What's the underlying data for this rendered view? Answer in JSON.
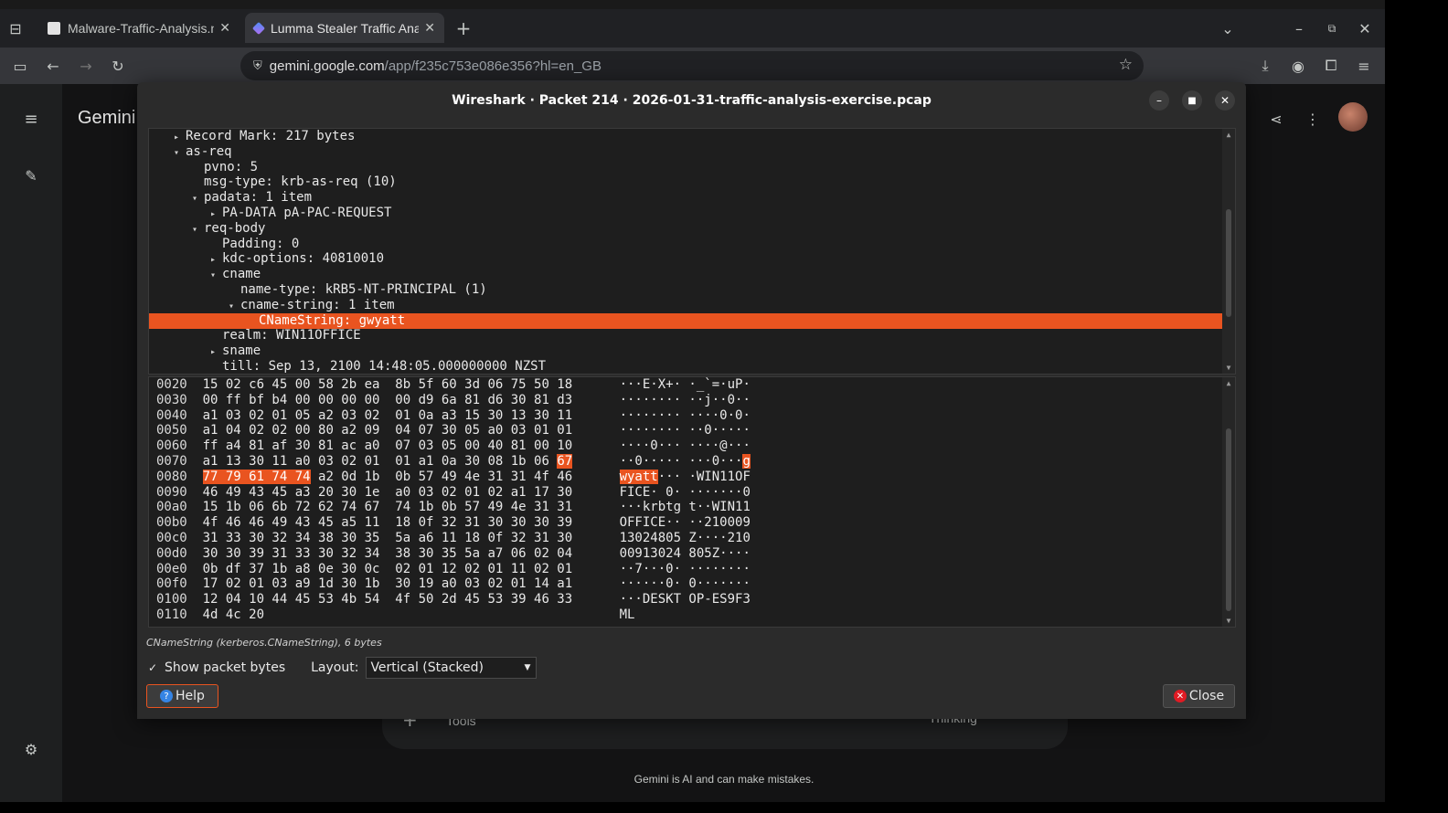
{
  "browser": {
    "tabs": [
      {
        "title": "Malware-Traffic-Analysis.net",
        "close": "✕"
      },
      {
        "title": "Lumma Stealer Traffic Analysis",
        "close": "✕"
      }
    ],
    "new_tab": "+",
    "url_host": "gemini.google.com",
    "url_path": "/app/f235c753e086e356?hl=en_GB"
  },
  "gemini": {
    "title": "Gemini",
    "disclaimer": "Gemini is AI and can make mistakes.",
    "tools_label": "Tools",
    "mode_label": "Thinking"
  },
  "wireshark": {
    "title": "Wireshark · Packet 214 · 2026-01-31-traffic-analysis-exercise.pcap",
    "tree": [
      {
        "indent": 1,
        "arrow": "▸",
        "text": "Record Mark: 217 bytes"
      },
      {
        "indent": 1,
        "arrow": "▾",
        "text": "as-req"
      },
      {
        "indent": 2,
        "arrow": "",
        "text": "pvno: 5"
      },
      {
        "indent": 2,
        "arrow": "",
        "text": "msg-type: krb-as-req (10)"
      },
      {
        "indent": 2,
        "arrow": "▾",
        "text": "padata: 1 item"
      },
      {
        "indent": 3,
        "arrow": "▸",
        "text": "PA-DATA pA-PAC-REQUEST"
      },
      {
        "indent": 2,
        "arrow": "▾",
        "text": "req-body"
      },
      {
        "indent": 3,
        "arrow": "",
        "text": "Padding: 0"
      },
      {
        "indent": 3,
        "arrow": "▸",
        "text": "kdc-options: 40810010"
      },
      {
        "indent": 3,
        "arrow": "▾",
        "text": "cname"
      },
      {
        "indent": 4,
        "arrow": "",
        "text": "name-type: kRB5-NT-PRINCIPAL (1)"
      },
      {
        "indent": 4,
        "arrow": "▾",
        "text": "cname-string: 1 item"
      },
      {
        "indent": 5,
        "arrow": "",
        "text": "CNameString: gwyatt",
        "selected": true
      },
      {
        "indent": 3,
        "arrow": "",
        "text": "realm: WIN11OFFICE"
      },
      {
        "indent": 3,
        "arrow": "▸",
        "text": "sname"
      },
      {
        "indent": 3,
        "arrow": "",
        "text": "till: Sep 13, 2100 14:48:05.000000000 NZST"
      }
    ],
    "hex": [
      {
        "off": "0020",
        "bytes": "15 02 c6 45 00 58 2b ea  8b 5f 60 3d 06 75 50 18",
        "ascii": "···E·X+· ·_`=·uP·"
      },
      {
        "off": "0030",
        "bytes": "00 ff bf b4 00 00 00 00  00 d9 6a 81 d6 30 81 d3",
        "ascii": "········ ··j··0··"
      },
      {
        "off": "0040",
        "bytes": "a1 03 02 01 05 a2 03 02  01 0a a3 15 30 13 30 11",
        "ascii": "········ ····0·0·"
      },
      {
        "off": "0050",
        "bytes": "a1 04 02 02 00 80 a2 09  04 07 30 05 a0 03 01 01",
        "ascii": "········ ··0·····"
      },
      {
        "off": "0060",
        "bytes": "ff a4 81 af 30 81 ac a0  07 03 05 00 40 81 00 10",
        "ascii": "····0··· ····@···"
      },
      {
        "off": "0070",
        "bytes_pre": "a1 13 30 11 a0 03 02 01  01 a1 0a 30 08 1b 06 ",
        "bytes_hl": "67",
        "ascii_pre": "··0····· ···0···",
        "ascii_hl": "g"
      },
      {
        "off": "0080",
        "bytes_hl": "77 79 61 74 74",
        "bytes_post": " a2 0d 1b  0b 57 49 4e 31 31 4f 46",
        "ascii_hl": "wyatt",
        "ascii_post": "··· ·WIN11OF"
      },
      {
        "off": "0090",
        "bytes": "46 49 43 45 a3 20 30 1e  a0 03 02 01 02 a1 17 30",
        "ascii": "FICE· 0· ·······0"
      },
      {
        "off": "00a0",
        "bytes": "15 1b 06 6b 72 62 74 67  74 1b 0b 57 49 4e 31 31",
        "ascii": "···krbtg t··WIN11"
      },
      {
        "off": "00b0",
        "bytes": "4f 46 46 49 43 45 a5 11  18 0f 32 31 30 30 30 39",
        "ascii": "OFFICE·· ··210009"
      },
      {
        "off": "00c0",
        "bytes": "31 33 30 32 34 38 30 35  5a a6 11 18 0f 32 31 30",
        "ascii": "13024805 Z····210"
      },
      {
        "off": "00d0",
        "bytes": "30 30 39 31 33 30 32 34  38 30 35 5a a7 06 02 04",
        "ascii": "00913024 805Z····"
      },
      {
        "off": "00e0",
        "bytes": "0b df 37 1b a8 0e 30 0c  02 01 12 02 01 11 02 01",
        "ascii": "··7···0· ········"
      },
      {
        "off": "00f0",
        "bytes": "17 02 01 03 a9 1d 30 1b  30 19 a0 03 02 01 14 a1",
        "ascii": "······0· 0·······"
      },
      {
        "off": "0100",
        "bytes": "12 04 10 44 45 53 4b 54  4f 50 2d 45 53 39 46 33",
        "ascii": "···DESKT OP-ES9F3"
      },
      {
        "off": "0110",
        "bytes": "4d 4c 20",
        "ascii": "ML"
      }
    ],
    "status": "CNameString (kerberos.CNameString), 6 bytes",
    "show_bytes_label": "Show packet bytes",
    "layout_label": "Layout:",
    "layout_value": "Vertical (Stacked)",
    "help_label": "Help",
    "close_label": "Close"
  },
  "colors": {
    "accent": "#e95420"
  }
}
